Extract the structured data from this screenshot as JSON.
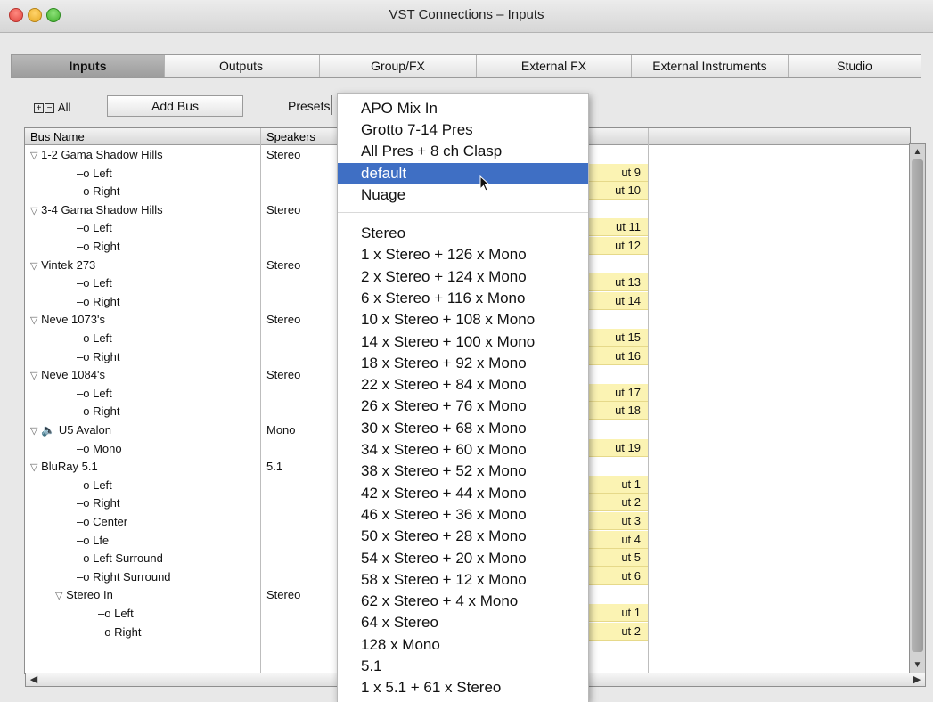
{
  "window": {
    "title": "VST Connections – Inputs"
  },
  "tabs": [
    {
      "label": "Inputs",
      "active": true
    },
    {
      "label": "Outputs",
      "active": false
    },
    {
      "label": "Group/FX",
      "active": false
    },
    {
      "label": "External FX",
      "active": false
    },
    {
      "label": "External Instruments",
      "active": false
    },
    {
      "label": "Studio",
      "active": false
    }
  ],
  "toolbar": {
    "expand_all_label": "All",
    "add_bus_label": "Add Bus",
    "presets_label": "Presets"
  },
  "grid": {
    "headers": {
      "bus_name": "Bus Name",
      "speakers": "Speakers"
    },
    "rows": [
      {
        "name": "1-2 Gama Shadow Hills",
        "speakers": "Stereo",
        "level": 0,
        "type": "bus",
        "port": ""
      },
      {
        "name": "Left",
        "speakers": "",
        "level": 1,
        "type": "ch",
        "port": "ut 9"
      },
      {
        "name": "Right",
        "speakers": "",
        "level": 1,
        "type": "ch",
        "port": "ut 10"
      },
      {
        "name": "3-4 Gama Shadow Hills",
        "speakers": "Stereo",
        "level": 0,
        "type": "bus",
        "port": ""
      },
      {
        "name": "Left",
        "speakers": "",
        "level": 1,
        "type": "ch",
        "port": "ut 11"
      },
      {
        "name": "Right",
        "speakers": "",
        "level": 1,
        "type": "ch",
        "port": "ut 12"
      },
      {
        "name": "Vintek 273",
        "speakers": "Stereo",
        "level": 0,
        "type": "bus",
        "port": ""
      },
      {
        "name": "Left",
        "speakers": "",
        "level": 1,
        "type": "ch",
        "port": "ut 13"
      },
      {
        "name": "Right",
        "speakers": "",
        "level": 1,
        "type": "ch",
        "port": "ut 14"
      },
      {
        "name": "Neve 1073's",
        "speakers": "Stereo",
        "level": 0,
        "type": "bus",
        "port": ""
      },
      {
        "name": "Left",
        "speakers": "",
        "level": 1,
        "type": "ch",
        "port": "ut 15"
      },
      {
        "name": "Right",
        "speakers": "",
        "level": 1,
        "type": "ch",
        "port": "ut 16"
      },
      {
        "name": "Neve 1084's",
        "speakers": "Stereo",
        "level": 0,
        "type": "bus",
        "port": ""
      },
      {
        "name": "Left",
        "speakers": "",
        "level": 1,
        "type": "ch",
        "port": "ut 17"
      },
      {
        "name": "Right",
        "speakers": "",
        "level": 1,
        "type": "ch",
        "port": "ut 18"
      },
      {
        "name": "U5 Avalon",
        "speakers": "Mono",
        "level": 0,
        "type": "bus-audio",
        "port": ""
      },
      {
        "name": "Mono",
        "speakers": "",
        "level": 1,
        "type": "ch",
        "port": "ut 19"
      },
      {
        "name": "BluRay 5.1",
        "speakers": "5.1",
        "level": 0,
        "type": "bus",
        "port": ""
      },
      {
        "name": "Left",
        "speakers": "",
        "level": 1,
        "type": "ch",
        "port": "ut 1"
      },
      {
        "name": "Right",
        "speakers": "",
        "level": 1,
        "type": "ch",
        "port": "ut 2"
      },
      {
        "name": "Center",
        "speakers": "",
        "level": 1,
        "type": "ch",
        "port": "ut 3"
      },
      {
        "name": "Lfe",
        "speakers": "",
        "level": 1,
        "type": "ch",
        "port": "ut 4"
      },
      {
        "name": "Left Surround",
        "speakers": "",
        "level": 1,
        "type": "ch",
        "port": "ut 5"
      },
      {
        "name": "Right Surround",
        "speakers": "",
        "level": 1,
        "type": "ch",
        "port": "ut 6"
      },
      {
        "name": "Stereo In",
        "speakers": "Stereo",
        "level": 1,
        "type": "bus",
        "port": ""
      },
      {
        "name": "Left",
        "speakers": "",
        "level": 2,
        "type": "ch",
        "port": "ut 1"
      },
      {
        "name": "Right",
        "speakers": "",
        "level": 2,
        "type": "ch",
        "port": "ut 2"
      }
    ]
  },
  "presets_menu": {
    "user_presets": [
      "APO Mix In",
      "Grotto 7-14 Pres",
      "All Pres + 8 ch Clasp",
      "default",
      "Nuage"
    ],
    "selected": "default",
    "factory_presets": [
      "Stereo",
      "1 x Stereo + 126 x Mono",
      "2 x Stereo + 124 x Mono",
      "6 x Stereo + 116 x Mono",
      "10 x Stereo + 108 x Mono",
      "14 x Stereo + 100 x Mono",
      "18 x Stereo + 92 x Mono",
      "22 x Stereo + 84 x Mono",
      "26 x Stereo + 76 x Mono",
      "30 x Stereo + 68 x Mono",
      "34 x Stereo + 60 x Mono",
      "38 x Stereo + 52 x Mono",
      "42 x Stereo + 44 x Mono",
      "46 x Stereo + 36 x Mono",
      "50 x Stereo + 28 x Mono",
      "54 x Stereo + 20 x Mono",
      "58 x Stereo + 12 x Mono",
      "62 x Stereo + 4 x Mono",
      "64 x Stereo",
      "128 x Mono",
      "5.1",
      "1 x 5.1 + 61 x Stereo"
    ]
  },
  "colors": {
    "selection": "#3f6fc4",
    "port_highlight": "#fbf3b3"
  }
}
